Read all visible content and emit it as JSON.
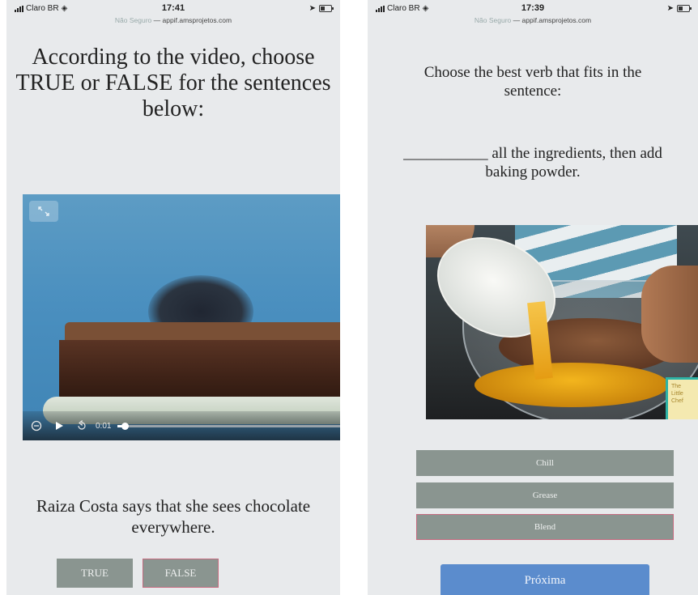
{
  "left_screen": {
    "status": {
      "carrier": "Claro BR",
      "time": "17:41",
      "site_hint": "Não Seguro",
      "url": "appif.amsprojetos.com",
      "icons": [
        "signal-icon",
        "wifi-icon",
        "location-icon",
        "battery-icon"
      ]
    },
    "title": "According to the video, choose TRUE or FALSE for the sentences below:",
    "video": {
      "elapsed": "0:01",
      "progress_fraction": 0.03,
      "controls": [
        "cc-icon",
        "play-icon",
        "replay-icon",
        "expand-icon"
      ]
    },
    "statement": "Raiza Costa says that she sees chocolate everywhere.",
    "buttons": {
      "true_label": "TRUE",
      "false_label": "FALSE"
    }
  },
  "right_screen": {
    "status": {
      "carrier": "Claro BR",
      "time": "17:39",
      "site_hint": "Não Seguro",
      "url": "appif.amsprojetos.com"
    },
    "title": "Choose the best verb that fits in the sentence:",
    "sentence": "___________ all the ingredients, then add baking powder.",
    "image_logo_text": "The Little Chef",
    "options": [
      "Chill",
      "Grease",
      "Blend"
    ],
    "next_label": "Próxima"
  },
  "colors": {
    "screen_bg": "#e8eaec",
    "option_bg": "#8a9590",
    "selected_border": "#c46b7f",
    "next_bg": "#5b8ccd"
  }
}
